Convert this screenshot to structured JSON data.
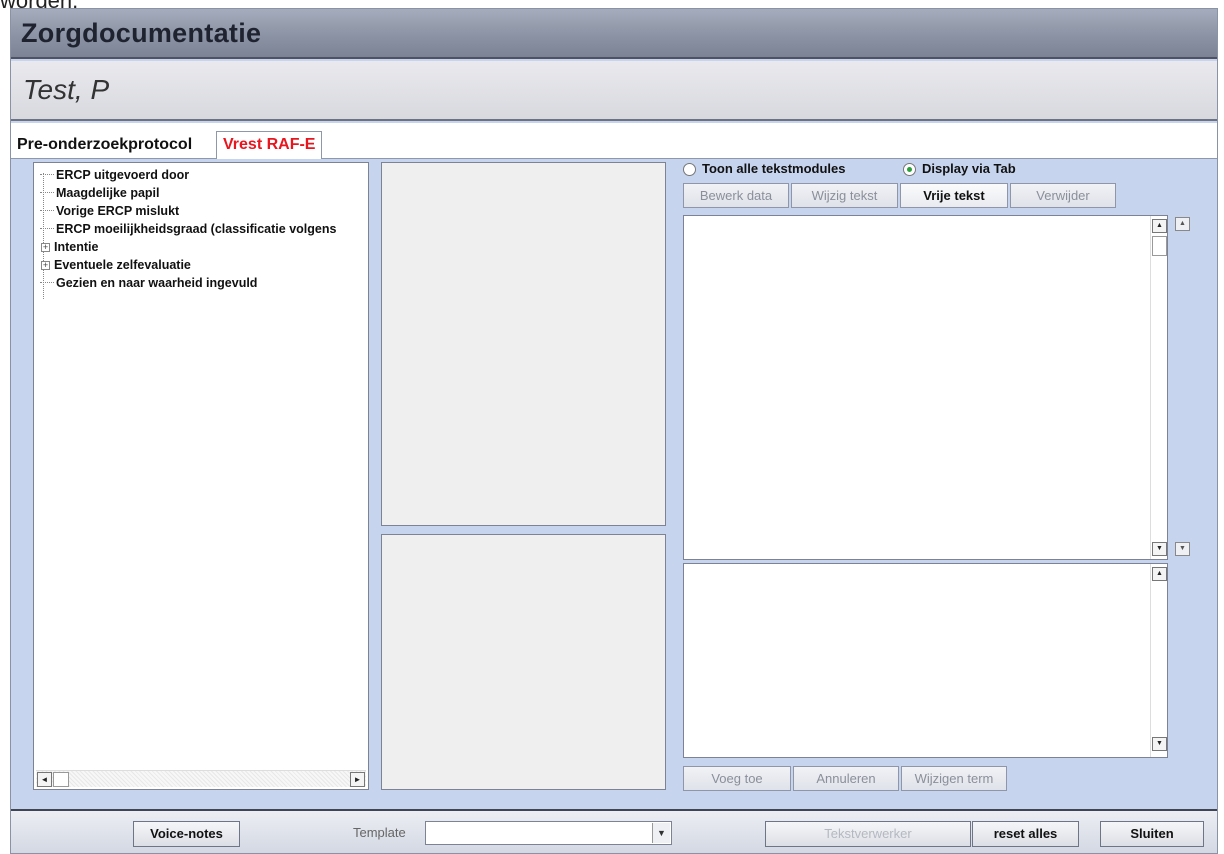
{
  "top_fragment": "worden.",
  "window": {
    "title": "Zorgdocumentatie",
    "patient_name": "Test, P"
  },
  "tabs": [
    {
      "label": "Pre-onderzoekprotocol",
      "active": false
    },
    {
      "label": "Vrest RAF-E",
      "active": true,
      "color": "#e8161e"
    }
  ],
  "tree": {
    "items": [
      {
        "label": "ERCP uitgevoerd door",
        "expandable": false
      },
      {
        "label": "Maagdelijke papil",
        "expandable": false
      },
      {
        "label": "Vorige ERCP mislukt",
        "expandable": false
      },
      {
        "label": "ERCP moeilijkheidsgraad (classificatie volgens",
        "expandable": false
      },
      {
        "label": "Intentie",
        "expandable": true
      },
      {
        "label": "Eventuele zelfevaluatie",
        "expandable": true
      },
      {
        "label": "Gezien en naar waarheid ingevuld",
        "expandable": false
      }
    ]
  },
  "options": {
    "show_all_label": "Toon alle tekstmodules",
    "display_tab_label": "Display via Tab",
    "selected": "Display via Tab"
  },
  "edit_buttons": {
    "bewerk": "Bewerk data",
    "wijzig": "Wijzig tekst",
    "vrije": "Vrije tekst",
    "verwijder": "Verwijder"
  },
  "action_buttons": {
    "voeg_toe": "Voeg toe",
    "annuleren": "Annuleren",
    "wijzigen_term": "Wijzigen term"
  },
  "footer": {
    "voice_notes": "Voice-notes",
    "template_label": "Template",
    "template_value": "",
    "tekstverwerker": "Tekstverwerker",
    "reset_alles": "reset alles",
    "sluiten": "Sluiten"
  },
  "icons": {
    "scroll_left": "◄",
    "scroll_right": "►",
    "scroll_up": "▲",
    "scroll_down": "▼",
    "dropdown": "▼",
    "expand": "+"
  }
}
